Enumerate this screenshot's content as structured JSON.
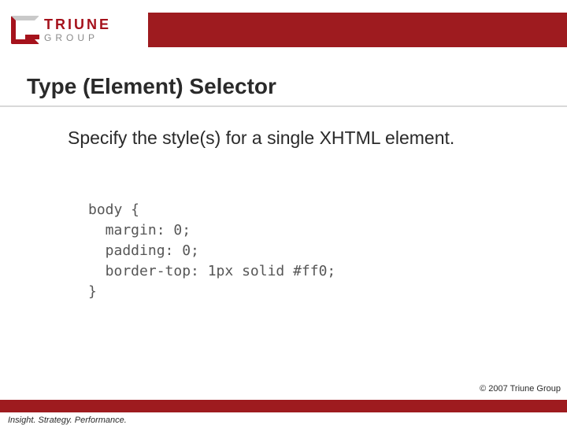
{
  "logo": {
    "name": "TRIUNE",
    "sub": "GROUP"
  },
  "title": "Type (Element) Selector",
  "body": "Specify the style(s) for a single XHTML element.",
  "code": "body {\n  margin: 0;\n  padding: 0;\n  border-top: 1px solid #ff0;\n}",
  "copyright": "© 2007 Triune Group",
  "tagline": "Insight. Strategy. Performance."
}
